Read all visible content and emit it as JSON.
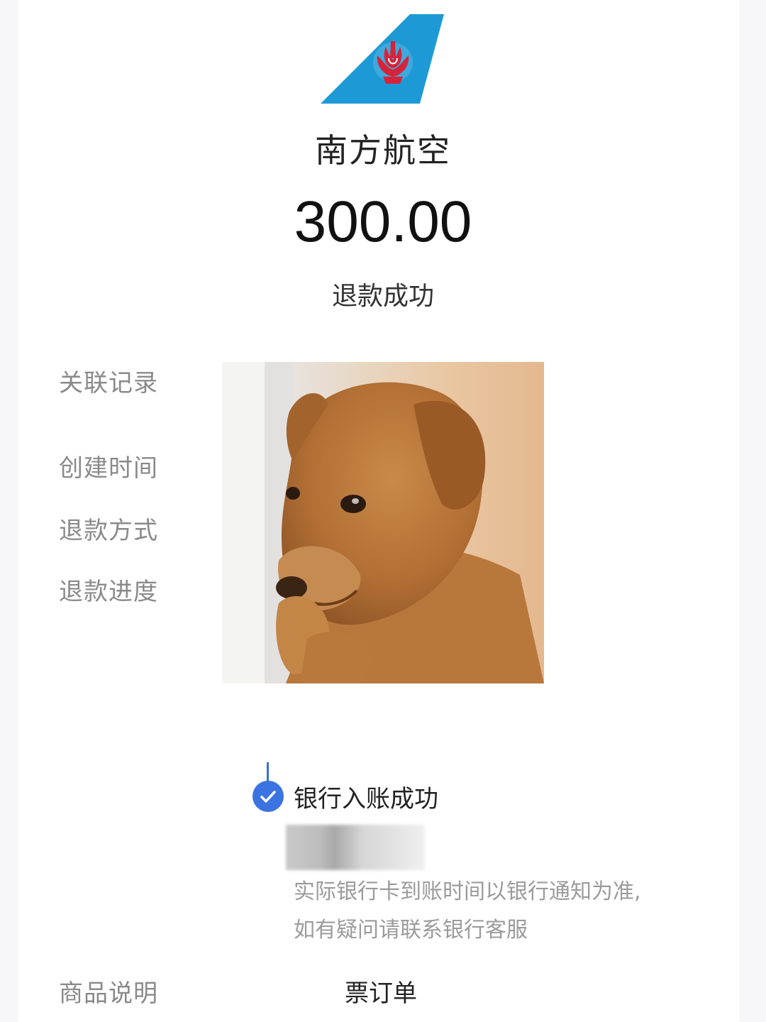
{
  "header": {
    "logo_icon": "china-southern-kapok-tail-logo",
    "airline_name": "南方航空",
    "amount": "300.00",
    "status": "退款成功"
  },
  "details": {
    "labels": [
      "关联记录",
      "创建时间",
      "退款方式",
      "退款进度"
    ]
  },
  "progress": {
    "title": "银行入账成功",
    "notice_line1": "实际银行卡到账时间以银行通知为准,",
    "notice_line2": "如有疑问请联系银行客服"
  },
  "product": {
    "label": "商品说明",
    "value": "票订单"
  },
  "colors": {
    "logo_blue": "#1d9ad6",
    "logo_red": "#d5233a",
    "check_blue": "#3b74e0"
  }
}
